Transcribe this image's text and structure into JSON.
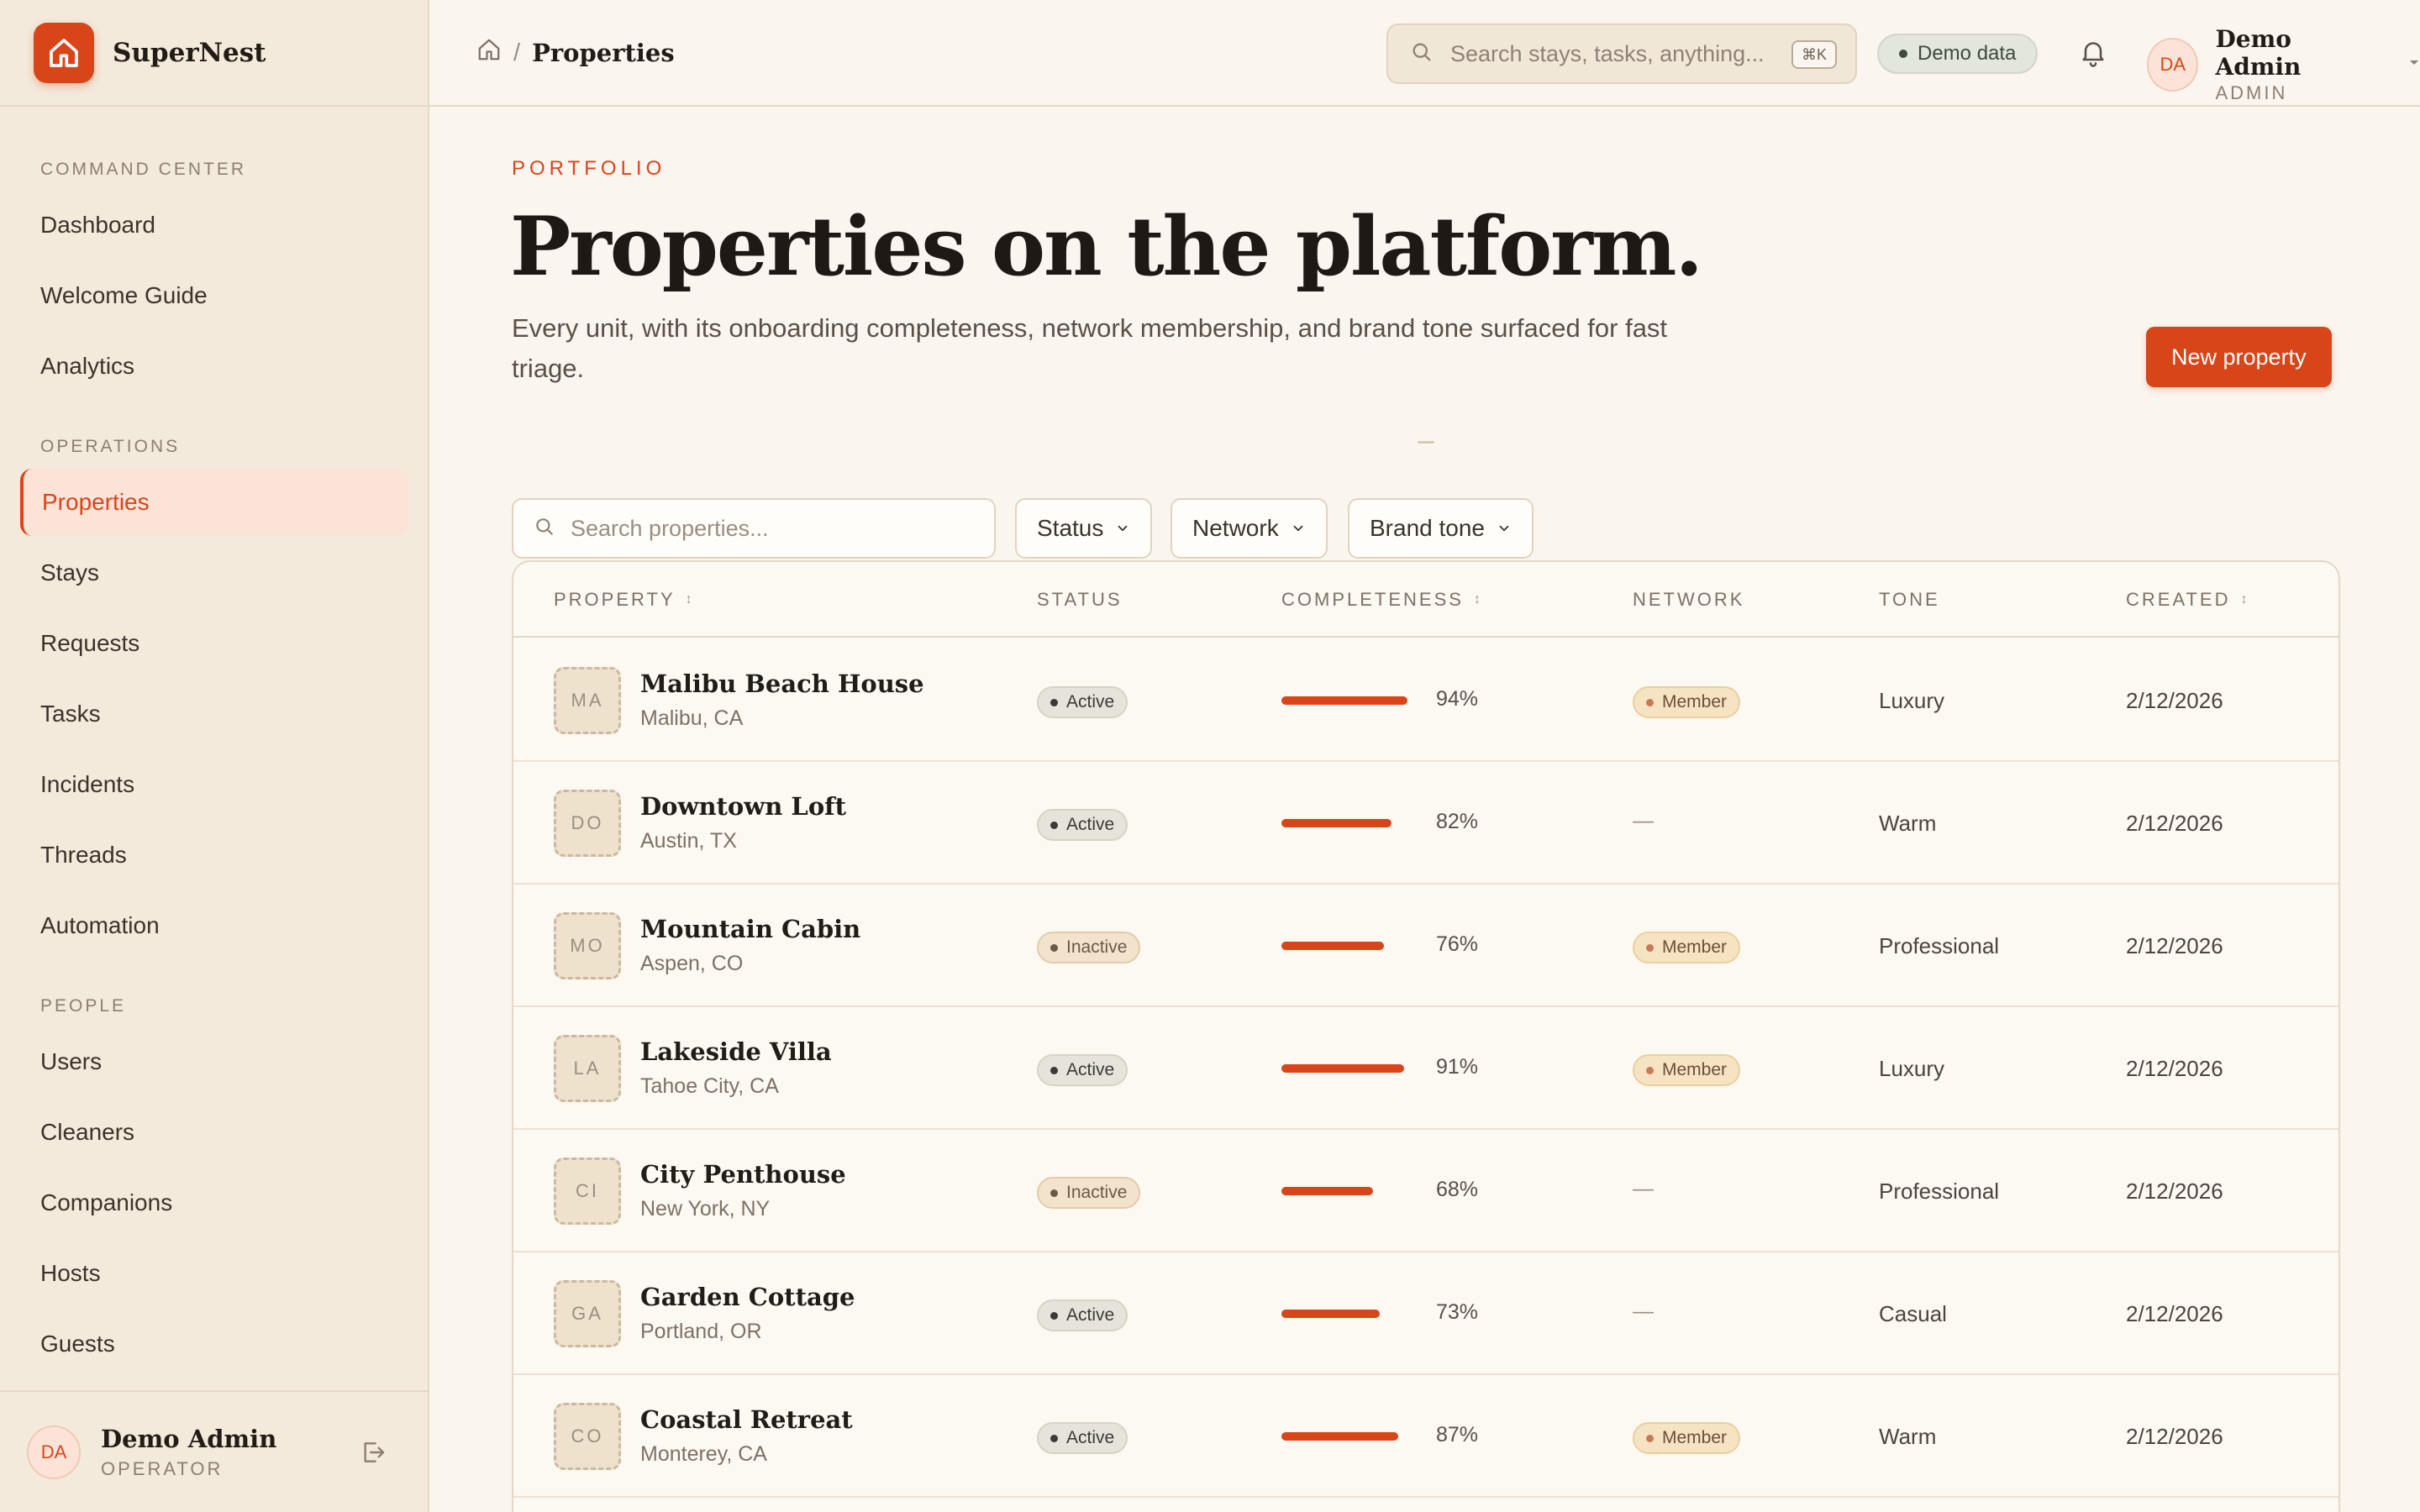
{
  "brand": {
    "name": "SuperNest",
    "logo_icon": "home-icon",
    "accent": "#d84519"
  },
  "sidebar": {
    "sections": [
      {
        "label": "COMMAND CENTER",
        "items": [
          "Dashboard",
          "Welcome Guide",
          "Analytics"
        ]
      },
      {
        "label": "OPERATIONS",
        "items": [
          "Properties",
          "Stays",
          "Requests",
          "Tasks",
          "Incidents",
          "Threads",
          "Automation"
        ]
      },
      {
        "label": "PEOPLE",
        "items": [
          "Users",
          "Cleaners",
          "Companions",
          "Hosts",
          "Guests"
        ]
      }
    ],
    "active_item": "Properties",
    "footer": {
      "initials": "DA",
      "name": "Demo Admin",
      "role": "OPERATOR",
      "logout_icon": "logout-icon"
    }
  },
  "topbar": {
    "breadcrumb": {
      "home_icon": "home-icon",
      "separator": "/",
      "current": "Properties"
    },
    "search": {
      "placeholder": "Search stays, tasks, anything...",
      "shortcut": "⌘K"
    },
    "demo_badge": "Demo data",
    "bell_icon": "bell-icon",
    "user": {
      "initials": "DA",
      "name": "Demo Admin",
      "role": "ADMIN"
    }
  },
  "page": {
    "eyebrow": "PORTFOLIO",
    "title": "Properties on the platform.",
    "subtitle": "Every unit, with its onboarding completeness, network membership, and brand tone surfaced for fast triage.",
    "primary_action": "New property",
    "separator": "—"
  },
  "filters": {
    "search_placeholder": "Search properties...",
    "status": "Status",
    "network": "Network",
    "brand_tone": "Brand tone"
  },
  "table": {
    "columns": [
      "PROPERTY",
      "STATUS",
      "COMPLETENESS",
      "NETWORK",
      "TONE",
      "CREATED"
    ],
    "rows": [
      {
        "initials": "MA",
        "name": "Malibu Beach House",
        "location": "Malibu, CA",
        "status": "Active",
        "completeness": 94,
        "completeness_label": "94%",
        "network": "Member",
        "tone": "Luxury",
        "created": "2/12/2026"
      },
      {
        "initials": "DO",
        "name": "Downtown Loft",
        "location": "Austin, TX",
        "status": "Active",
        "completeness": 82,
        "completeness_label": "82%",
        "network": "—",
        "tone": "Warm",
        "created": "2/12/2026"
      },
      {
        "initials": "MO",
        "name": "Mountain Cabin",
        "location": "Aspen, CO",
        "status": "Inactive",
        "completeness": 76,
        "completeness_label": "76%",
        "network": "Member",
        "tone": "Professional",
        "created": "2/12/2026"
      },
      {
        "initials": "LA",
        "name": "Lakeside Villa",
        "location": "Tahoe City, CA",
        "status": "Active",
        "completeness": 91,
        "completeness_label": "91%",
        "network": "Member",
        "tone": "Luxury",
        "created": "2/12/2026"
      },
      {
        "initials": "CI",
        "name": "City Penthouse",
        "location": "New York, NY",
        "status": "Inactive",
        "completeness": 68,
        "completeness_label": "68%",
        "network": "—",
        "tone": "Professional",
        "created": "2/12/2026"
      },
      {
        "initials": "GA",
        "name": "Garden Cottage",
        "location": "Portland, OR",
        "status": "Active",
        "completeness": 73,
        "completeness_label": "73%",
        "network": "—",
        "tone": "Casual",
        "created": "2/12/2026"
      },
      {
        "initials": "CO",
        "name": "Coastal Retreat",
        "location": "Monterey, CA",
        "status": "Active",
        "completeness": 87,
        "completeness_label": "87%",
        "network": "Member",
        "tone": "Warm",
        "created": "2/12/2026"
      }
    ]
  }
}
